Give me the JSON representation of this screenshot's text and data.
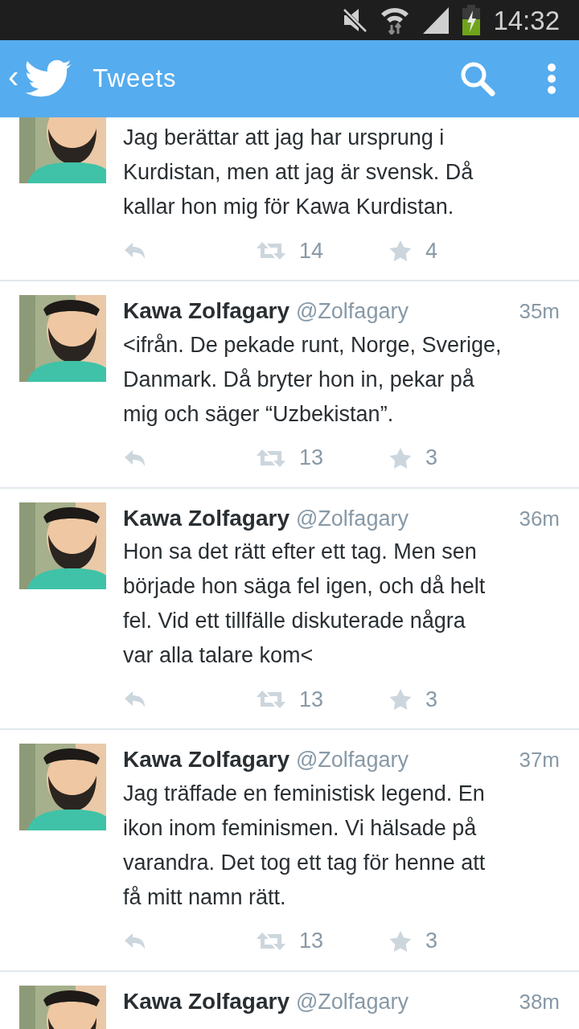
{
  "status_bar": {
    "time": "14:32"
  },
  "app_bar": {
    "back": "‹",
    "title": "Tweets"
  },
  "tweets": [
    {
      "text": "Jag berättar att jag har ursprung i\nKurdistan, men att jag är svensk. Då\nkallar hon mig för Kawa Kurdistan.",
      "retweets": "14",
      "favorites": "4"
    },
    {
      "name": "Kawa Zolfagary",
      "handle": "@Zolfagary",
      "time": "35m",
      "text": "<ifrån. De pekade runt, Norge, Sverige,\nDanmark. Då bryter hon in, pekar på\nmig och säger “Uzbekistan”.",
      "retweets": "13",
      "favorites": "3"
    },
    {
      "name": "Kawa Zolfagary",
      "handle": "@Zolfagary",
      "time": "36m",
      "text": "Hon sa det rätt efter ett tag. Men sen\nbörjade hon säga fel igen, och då helt\nfel. Vid ett tillfälle diskuterade några\nvar alla talare kom<",
      "retweets": "13",
      "favorites": "3"
    },
    {
      "name": "Kawa Zolfagary",
      "handle": "@Zolfagary",
      "time": "37m",
      "text": "Jag träffade en feministisk legend. En\nikon inom feminismen. Vi hälsade på\nvarandra. Det tog ett tag för henne att\nfå mitt namn rätt.",
      "retweets": "13",
      "favorites": "3"
    },
    {
      "name": "Kawa Zolfagary",
      "handle": "@Zolfagary",
      "time": "38m"
    }
  ]
}
